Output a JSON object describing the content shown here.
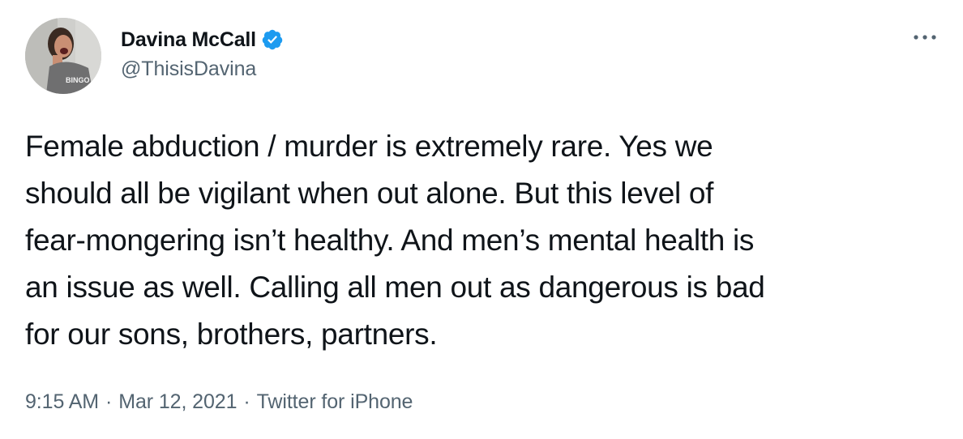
{
  "user": {
    "display_name": "Davina McCall",
    "handle": "@ThisisDavina",
    "verified": true,
    "avatar_icon": "profile-photo",
    "avatar_shirt_text": "BINGO"
  },
  "icons": {
    "more": "more-horizontal-icon",
    "verified": "verified-badge-icon"
  },
  "colors": {
    "text_primary": "#0f1419",
    "text_secondary": "#536471",
    "verified_blue": "#1d9bf0"
  },
  "tweet": {
    "text": "Female abduction / murder is extremely rare. Yes we should all be vigilant when out alone. But this level of fear-mongering isn’t healthy. And men’s mental health is an issue as well. Calling all men out as dangerous is bad for our sons, brothers, partners.",
    "lines": [
      "Female abduction / murder is extremely rare. Yes we",
      "should all be vigilant when out alone. But this level of",
      "fear-mongering isn’t healthy. And men’s mental health is",
      "an issue as well. Calling all men out as dangerous is bad",
      "for our sons, brothers, partners."
    ]
  },
  "meta": {
    "time": "9:15 AM",
    "separator": "·",
    "date": "Mar 12, 2021",
    "source": "Twitter for iPhone"
  }
}
